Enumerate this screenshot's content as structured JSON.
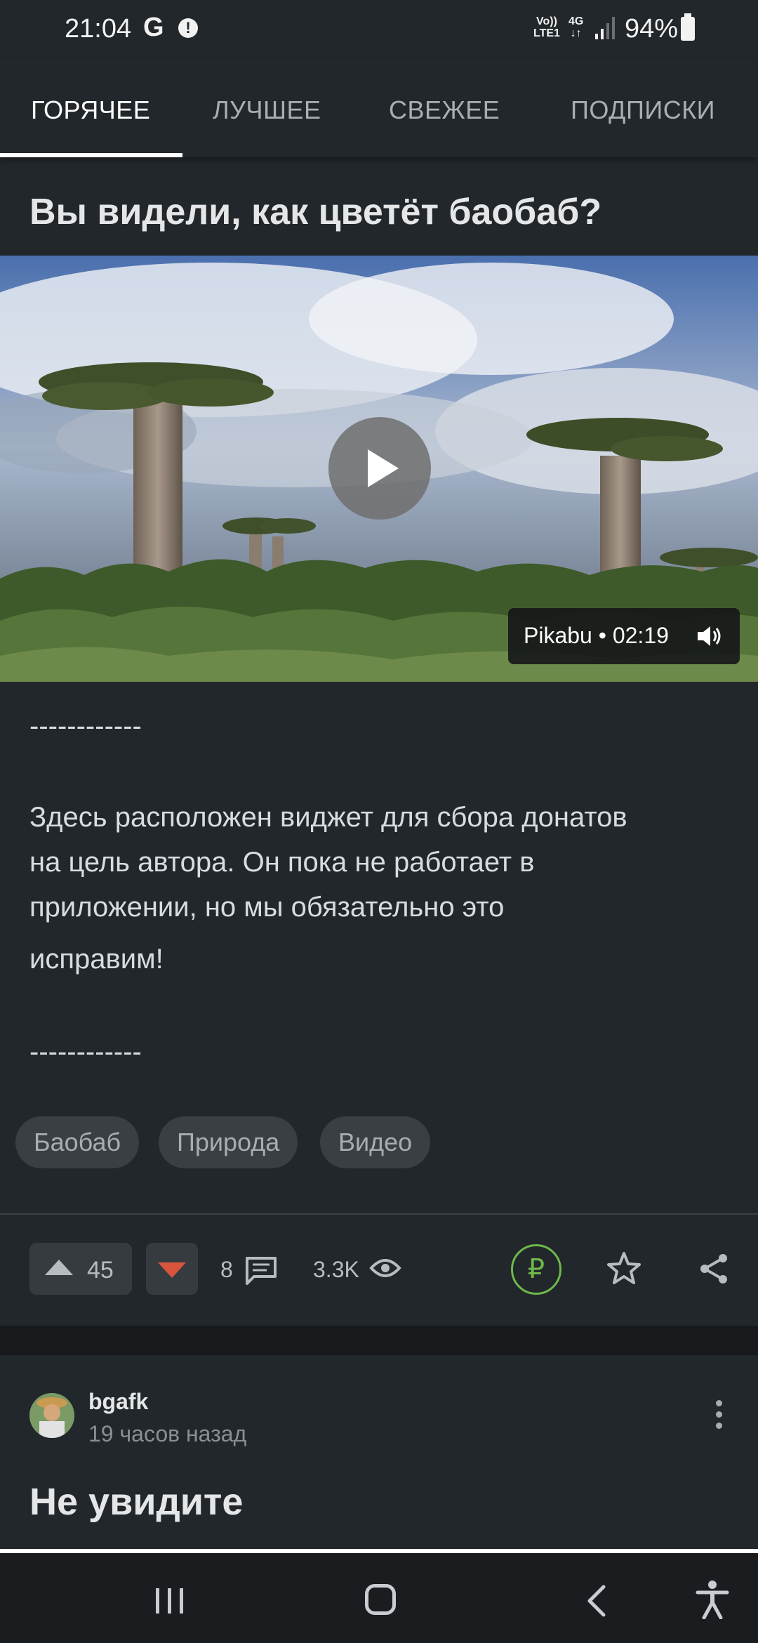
{
  "status_bar": {
    "time": "21:04",
    "google_glyph": "G",
    "alert_glyph": "!",
    "network_top": "Vo))",
    "network_bottom": "LTE1",
    "data_top": "4G",
    "data_bottom": "↓↑",
    "battery": "94%"
  },
  "tabs": [
    {
      "label": "ГОРЯЧЕЕ",
      "active": true
    },
    {
      "label": "ЛУЧШЕЕ",
      "active": false
    },
    {
      "label": "СВЕЖЕЕ",
      "active": false
    },
    {
      "label": "ПОДПИСКИ",
      "active": false
    }
  ],
  "post": {
    "title": "Вы видели, как цветёт баобаб?",
    "video": {
      "badge": "Pikabu • 02:19"
    },
    "separator_1": "------------",
    "widget_text_lines": [
      "Здесь расположен виджет для сбора донатов",
      "на цель автора. Он пока не работает в",
      "приложении, но мы обязательно это",
      "исправим!"
    ],
    "separator_2": "------------",
    "tags": [
      "Баобаб",
      "Природа",
      "Видео"
    ],
    "rating": "45",
    "comments": "8",
    "views": "3.3K",
    "donate_symbol": "₽"
  },
  "next_post": {
    "author": "bgafk",
    "time": "19 часов назад",
    "title": "Не увидите"
  },
  "colors": {
    "background": "#22272b",
    "accent_donate": "#6fb84a",
    "downvote": "#d8553c"
  }
}
